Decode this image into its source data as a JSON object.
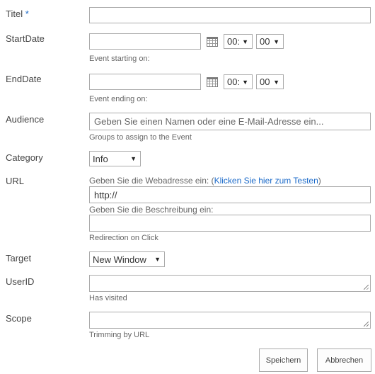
{
  "fields": {
    "title": {
      "label": "Titel",
      "required_mark": "*",
      "value": ""
    },
    "start": {
      "label": "StartDate",
      "date": "",
      "hour": "00:",
      "minute": "00",
      "hint": "Event starting on:"
    },
    "end": {
      "label": "EndDate",
      "date": "",
      "hour": "00:",
      "minute": "00",
      "hint": "Event ending on:"
    },
    "audience": {
      "label": "Audience",
      "placeholder": "Geben Sie einen Namen oder eine E-Mail-Adresse ein...",
      "hint": "Groups to assign to the Event"
    },
    "category": {
      "label": "Category",
      "selected": "Info"
    },
    "url": {
      "label": "URL",
      "address_prompt": "Geben Sie die Webadresse ein: (",
      "test_link": "Klicken Sie hier zum Testen",
      "address_prompt_end": ")",
      "address_value": "http://",
      "description_prompt": "Geben Sie die Beschreibung ein:",
      "description_value": "",
      "hint": "Redirection on Click"
    },
    "target": {
      "label": "Target",
      "selected": "New Window"
    },
    "userid": {
      "label": "UserID",
      "value": "",
      "hint": "Has visited"
    },
    "scope": {
      "label": "Scope",
      "value": "",
      "hint": "Trimming by URL"
    }
  },
  "buttons": {
    "save": "Speichern",
    "cancel": "Abbrechen"
  },
  "icons": {
    "calendar": "calendar-icon",
    "dropdown": "chevron-down-icon"
  }
}
